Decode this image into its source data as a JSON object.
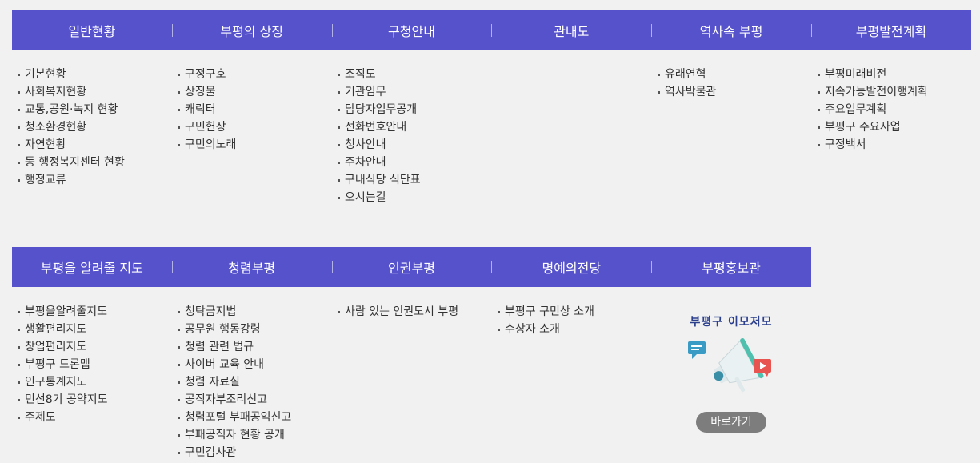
{
  "top_menu": [
    {
      "title": "일반현황",
      "items": [
        "기본현황",
        "사회복지현황",
        "교통,공원·녹지 현황",
        "청소환경현황",
        "자연현황",
        "동 행정복지센터 현황",
        "행정교류"
      ]
    },
    {
      "title": "부평의 상징",
      "items": [
        "구정구호",
        "상징물",
        "캐릭터",
        "구민헌장",
        "구민의노래"
      ]
    },
    {
      "title": "구청안내",
      "items": [
        "조직도",
        "기관임무",
        "담당자업무공개",
        "전화번호안내",
        "청사안내",
        "주차안내",
        "구내식당 식단표",
        "오시는길"
      ]
    },
    {
      "title": "관내도",
      "items": []
    },
    {
      "title": "역사속 부평",
      "items": [
        "유래연혁",
        "역사박물관"
      ]
    },
    {
      "title": "부평발전계획",
      "items": [
        "부평미래비전",
        "지속가능발전이행계획",
        "주요업무계획",
        "부평구 주요사업",
        "구정백서"
      ]
    }
  ],
  "bottom_menu": [
    {
      "title": "부평을 알려줄 지도",
      "items": [
        "부평을알려줄지도",
        "생활편리지도",
        "창업편리지도",
        "부평구 드론맵",
        "인구통계지도",
        "민선8기 공약지도",
        "주제도"
      ]
    },
    {
      "title": "청렴부평",
      "items": [
        "청탁금지법",
        "공무원 행동강령",
        "청렴 관련 법규",
        "사이버 교육 안내",
        "청렴 자료실",
        "공직자부조리신고",
        "청렴포털 부패공익신고",
        "부패공직자 현황 공개",
        "구민감사관"
      ]
    },
    {
      "title": "인권부평",
      "items": [
        "사람 있는 인권도시 부평"
      ]
    },
    {
      "title": "명예의전당",
      "items": [
        "부평구 구민상 소개",
        "수상자 소개"
      ]
    },
    {
      "title": "부평홍보관",
      "items": []
    }
  ],
  "promo": {
    "title": "부평구 이모저모",
    "button_label": "바로가기",
    "icons": [
      "megaphone-icon",
      "chat-bubble-icon",
      "play-icon"
    ]
  },
  "colors": {
    "header_bg": "#5552cc",
    "header_text": "#ffffff",
    "body_text": "#333333",
    "page_bg": "#f1f1f1",
    "button_bg": "#7d7d7d"
  }
}
